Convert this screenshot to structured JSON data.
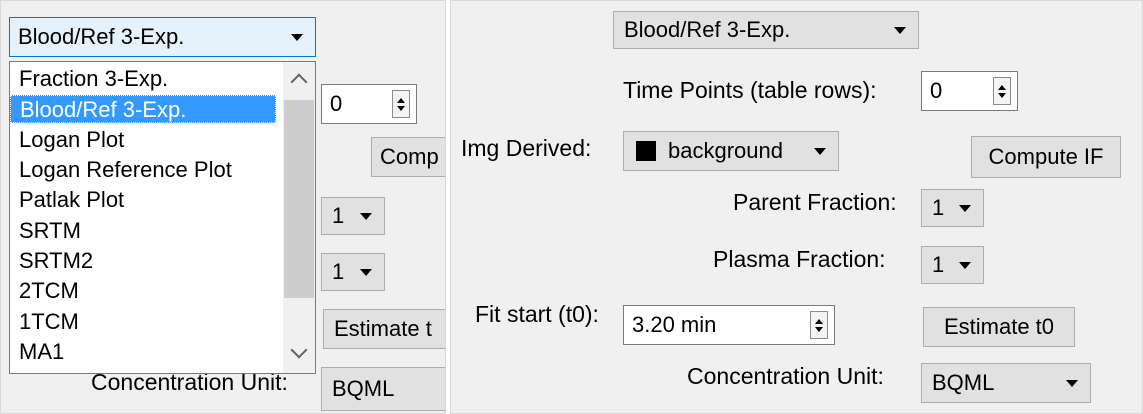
{
  "left": {
    "model_select": "Blood/Ref 3-Exp.",
    "model_options": [
      "Fraction 3-Exp.",
      "Blood/Ref 3-Exp.",
      "Logan Plot",
      "Logan Reference Plot",
      "Patlak Plot",
      "SRTM",
      "SRTM2",
      "2TCM",
      "1TCM",
      "MA1"
    ],
    "time_points_value": "0",
    "compute_button_partial": "Comp",
    "parent_fraction_value": "1",
    "plasma_fraction_value": "1",
    "estimate_button_partial": "Estimate t",
    "concentration_unit_label_partial": "Concentration Unit:",
    "concentration_unit_value": "BQML"
  },
  "right": {
    "model_select": "Blood/Ref 3-Exp.",
    "time_points_label": "Time Points (table rows):",
    "time_points_value": "0",
    "img_derived_label": "Img Derived:",
    "img_derived_value": "background",
    "compute_if_button": "Compute IF",
    "parent_fraction_label": "Parent Fraction:",
    "parent_fraction_value": "1",
    "plasma_fraction_label": "Plasma Fraction:",
    "plasma_fraction_value": "1",
    "fit_start_label": "Fit start (t0):",
    "fit_start_value": "3.20 min",
    "estimate_t0_button": "Estimate t0",
    "concentration_unit_label": "Concentration Unit:",
    "concentration_unit_value": "BQML"
  },
  "colors": {
    "selection": "#3399ff",
    "panel_bg": "#f0f0f0",
    "button_bg": "#e1e1e1"
  },
  "icons": [
    "chevron-up-icon",
    "chevron-down-icon",
    "caret-down-icon",
    "spinner-icon",
    "color-swatch-icon"
  ]
}
